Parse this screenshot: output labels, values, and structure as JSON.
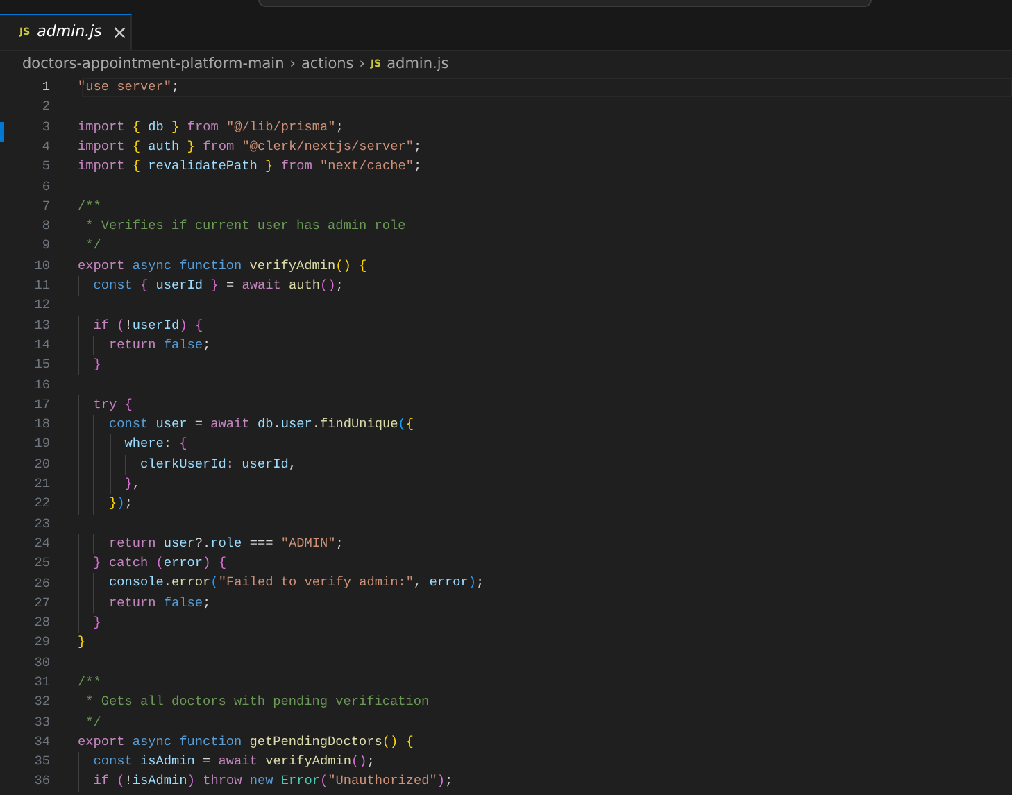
{
  "tab": {
    "icon": "JS",
    "label": "admin.js",
    "close": "×",
    "selected": true
  },
  "breadcrumb": {
    "folders": [
      "doctors-appointment-platform-main",
      "actions"
    ],
    "separator": "›",
    "file_icon": "JS",
    "file": "admin.js"
  },
  "lines": [
    {
      "number": "1",
      "current": true,
      "tokens": [
        {
          "kind": "string",
          "text": "\"use server\""
        },
        {
          "kind": "plain",
          "text": ";"
        }
      ]
    },
    {
      "number": "2",
      "current": false
    },
    {
      "number": "3",
      "current": false,
      "tokens": [
        {
          "kind": "keyword",
          "text": "import "
        },
        {
          "kind": "bracket1",
          "text": "{"
        },
        {
          "kind": "variable",
          "text": " db "
        },
        {
          "kind": "bracket1",
          "text": "}"
        },
        {
          "kind": "keyword",
          "text": " from "
        },
        {
          "kind": "string",
          "text": "\"@/lib/prisma\""
        },
        {
          "kind": "plain",
          "text": ";"
        }
      ]
    },
    {
      "number": "4",
      "current": false,
      "tokens": [
        {
          "kind": "keyword",
          "text": "import "
        },
        {
          "kind": "bracket1",
          "text": "{"
        },
        {
          "kind": "variable",
          "text": " auth "
        },
        {
          "kind": "bracket1",
          "text": "}"
        },
        {
          "kind": "keyword",
          "text": " from "
        },
        {
          "kind": "string",
          "text": "\"@clerk/nextjs/server\""
        },
        {
          "kind": "plain",
          "text": ";"
        }
      ]
    },
    {
      "number": "5",
      "current": false,
      "tokens": [
        {
          "kind": "keyword",
          "text": "import "
        },
        {
          "kind": "bracket1",
          "text": "{"
        },
        {
          "kind": "variable",
          "text": " revalidatePath "
        },
        {
          "kind": "bracket1",
          "text": "}"
        },
        {
          "kind": "keyword",
          "text": " from "
        },
        {
          "kind": "string",
          "text": "\"next/cache\""
        },
        {
          "kind": "plain",
          "text": ";"
        }
      ]
    },
    {
      "number": "6",
      "current": false
    },
    {
      "number": "7",
      "current": false,
      "tokens": [
        {
          "kind": "comment",
          "text": "/**"
        }
      ]
    },
    {
      "number": "8",
      "current": false,
      "tokens": [
        {
          "kind": "comment",
          "text": " * Verifies if current user has admin role"
        }
      ]
    },
    {
      "number": "9",
      "current": false,
      "tokens": [
        {
          "kind": "comment",
          "text": " */"
        }
      ]
    },
    {
      "number": "10",
      "current": false,
      "tokens": [
        {
          "kind": "keyword",
          "text": "export "
        },
        {
          "kind": "storage",
          "text": "async function "
        },
        {
          "kind": "function",
          "text": "verifyAdmin"
        },
        {
          "kind": "bracket1",
          "text": "() {"
        }
      ]
    },
    {
      "number": "11",
      "current": false,
      "tokens": [
        {
          "kind": "storage",
          "text": "  const "
        },
        {
          "kind": "bracket2",
          "text": "{"
        },
        {
          "kind": "variable",
          "text": " userId "
        },
        {
          "kind": "bracket2",
          "text": "}"
        },
        {
          "kind": "plain",
          "text": " = "
        },
        {
          "kind": "keyword",
          "text": "await "
        },
        {
          "kind": "function",
          "text": "auth"
        },
        {
          "kind": "bracket2",
          "text": "()"
        },
        {
          "kind": "plain",
          "text": ";"
        }
      ]
    },
    {
      "number": "12",
      "current": false
    },
    {
      "number": "13",
      "current": false,
      "tokens": [
        {
          "kind": "keyword",
          "text": "  if "
        },
        {
          "kind": "bracket2",
          "text": "("
        },
        {
          "kind": "plain",
          "text": "!"
        },
        {
          "kind": "variable",
          "text": "userId"
        },
        {
          "kind": "bracket2",
          "text": ") {"
        }
      ]
    },
    {
      "number": "14",
      "current": false,
      "tokens": [
        {
          "kind": "keyword",
          "text": "    return "
        },
        {
          "kind": "storage",
          "text": "false"
        },
        {
          "kind": "plain",
          "text": ";"
        }
      ]
    },
    {
      "number": "15",
      "current": false,
      "tokens": [
        {
          "kind": "bracket2",
          "text": "  }"
        }
      ]
    },
    {
      "number": "16",
      "current": false
    },
    {
      "number": "17",
      "current": false,
      "tokens": [
        {
          "kind": "keyword",
          "text": "  try "
        },
        {
          "kind": "bracket2",
          "text": "{"
        }
      ]
    },
    {
      "number": "18",
      "current": false,
      "tokens": [
        {
          "kind": "storage",
          "text": "    const "
        },
        {
          "kind": "variable",
          "text": "user"
        },
        {
          "kind": "plain",
          "text": " = "
        },
        {
          "kind": "keyword",
          "text": "await "
        },
        {
          "kind": "variable",
          "text": "db"
        },
        {
          "kind": "plain",
          "text": "."
        },
        {
          "kind": "variable",
          "text": "user"
        },
        {
          "kind": "plain",
          "text": "."
        },
        {
          "kind": "function",
          "text": "findUnique"
        },
        {
          "kind": "bracket3",
          "text": "("
        },
        {
          "kind": "bracket1",
          "text": "{"
        }
      ]
    },
    {
      "number": "19",
      "current": false,
      "tokens": [
        {
          "kind": "variable",
          "text": "      where"
        },
        {
          "kind": "plain",
          "text": ": "
        },
        {
          "kind": "bracket2",
          "text": "{"
        }
      ]
    },
    {
      "number": "20",
      "current": false,
      "tokens": [
        {
          "kind": "variable",
          "text": "        clerkUserId"
        },
        {
          "kind": "plain",
          "text": ": "
        },
        {
          "kind": "variable",
          "text": "userId"
        },
        {
          "kind": "plain",
          "text": ","
        }
      ]
    },
    {
      "number": "21",
      "current": false,
      "tokens": [
        {
          "kind": "bracket2",
          "text": "      }"
        },
        {
          "kind": "plain",
          "text": ","
        }
      ]
    },
    {
      "number": "22",
      "current": false,
      "tokens": [
        {
          "kind": "bracket1",
          "text": "    }"
        },
        {
          "kind": "bracket3",
          "text": ")"
        },
        {
          "kind": "plain",
          "text": ";"
        }
      ]
    },
    {
      "number": "23",
      "current": false
    },
    {
      "number": "24",
      "current": false,
      "tokens": [
        {
          "kind": "keyword",
          "text": "    return "
        },
        {
          "kind": "variable",
          "text": "user"
        },
        {
          "kind": "plain",
          "text": "?."
        },
        {
          "kind": "variable",
          "text": "role"
        },
        {
          "kind": "plain",
          "text": " === "
        },
        {
          "kind": "string",
          "text": "\"ADMIN\""
        },
        {
          "kind": "plain",
          "text": ";"
        }
      ]
    },
    {
      "number": "25",
      "current": false,
      "tokens": [
        {
          "kind": "bracket2",
          "text": "  } "
        },
        {
          "kind": "keyword",
          "text": "catch "
        },
        {
          "kind": "bracket2",
          "text": "("
        },
        {
          "kind": "variable",
          "text": "error"
        },
        {
          "kind": "bracket2",
          "text": ") {"
        }
      ]
    },
    {
      "number": "26",
      "current": false,
      "tokens": [
        {
          "kind": "variable",
          "text": "    console"
        },
        {
          "kind": "plain",
          "text": "."
        },
        {
          "kind": "function",
          "text": "error"
        },
        {
          "kind": "bracket3",
          "text": "("
        },
        {
          "kind": "string",
          "text": "\"Failed to verify admin:\""
        },
        {
          "kind": "plain",
          "text": ", "
        },
        {
          "kind": "variable",
          "text": "error"
        },
        {
          "kind": "bracket3",
          "text": ")"
        },
        {
          "kind": "plain",
          "text": ";"
        }
      ]
    },
    {
      "number": "27",
      "current": false,
      "tokens": [
        {
          "kind": "keyword",
          "text": "    return "
        },
        {
          "kind": "storage",
          "text": "false"
        },
        {
          "kind": "plain",
          "text": ";"
        }
      ]
    },
    {
      "number": "28",
      "current": false,
      "tokens": [
        {
          "kind": "bracket2",
          "text": "  }"
        }
      ]
    },
    {
      "number": "29",
      "current": false,
      "tokens": [
        {
          "kind": "bracket1",
          "text": "}"
        }
      ]
    },
    {
      "number": "30",
      "current": false
    },
    {
      "number": "31",
      "current": false,
      "tokens": [
        {
          "kind": "comment",
          "text": "/**"
        }
      ]
    },
    {
      "number": "32",
      "current": false,
      "tokens": [
        {
          "kind": "comment",
          "text": " * Gets all doctors with pending verification"
        }
      ]
    },
    {
      "number": "33",
      "current": false,
      "tokens": [
        {
          "kind": "comment",
          "text": " */"
        }
      ]
    },
    {
      "number": "34",
      "current": false,
      "tokens": [
        {
          "kind": "keyword",
          "text": "export "
        },
        {
          "kind": "storage",
          "text": "async function "
        },
        {
          "kind": "function",
          "text": "getPendingDoctors"
        },
        {
          "kind": "bracket1",
          "text": "() {"
        }
      ]
    },
    {
      "number": "35",
      "current": false,
      "tokens": [
        {
          "kind": "storage",
          "text": "  const "
        },
        {
          "kind": "variable",
          "text": "isAdmin"
        },
        {
          "kind": "plain",
          "text": " = "
        },
        {
          "kind": "keyword",
          "text": "await "
        },
        {
          "kind": "function",
          "text": "verifyAdmin"
        },
        {
          "kind": "bracket2",
          "text": "()"
        },
        {
          "kind": "plain",
          "text": ";"
        }
      ]
    },
    {
      "number": "36",
      "current": false,
      "tokens": [
        {
          "kind": "keyword",
          "text": "  if "
        },
        {
          "kind": "bracket2",
          "text": "("
        },
        {
          "kind": "plain",
          "text": "!"
        },
        {
          "kind": "variable",
          "text": "isAdmin"
        },
        {
          "kind": "bracket2",
          "text": ") "
        },
        {
          "kind": "keyword",
          "text": "throw "
        },
        {
          "kind": "storage",
          "text": "new "
        },
        {
          "kind": "class",
          "text": "Error"
        },
        {
          "kind": "bracket2",
          "text": "("
        },
        {
          "kind": "string",
          "text": "\"Unauthorized\""
        },
        {
          "kind": "bracket2",
          "text": ")"
        },
        {
          "kind": "plain",
          "text": ";"
        }
      ]
    }
  ]
}
